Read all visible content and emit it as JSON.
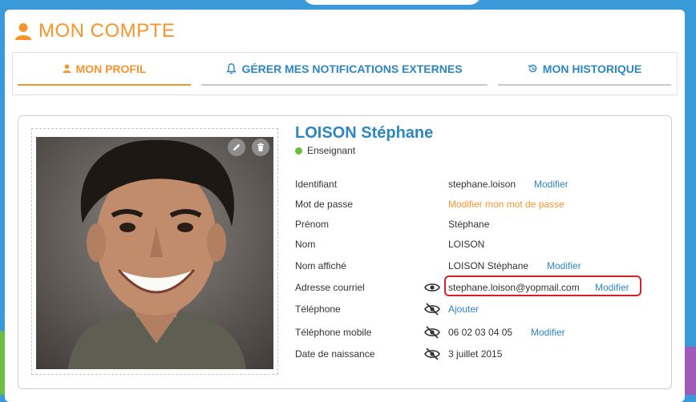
{
  "header": {
    "title": "MON COMPTE"
  },
  "tabs": [
    {
      "label": "MON PROFIL",
      "icon": "user-icon",
      "active": true
    },
    {
      "label": "GÉRER MES NOTIFICATIONS EXTERNES",
      "icon": "bell-icon",
      "active": false
    },
    {
      "label": "MON HISTORIQUE",
      "icon": "history-icon",
      "active": false
    }
  ],
  "profile": {
    "name": "LOISON Stéphane",
    "role": "Enseignant",
    "photo_actions": {
      "edit_icon": "pencil-icon",
      "delete_icon": "trash-icon"
    },
    "fields": {
      "identifiant": {
        "label": "Identifiant",
        "value": "stephane.loison",
        "action": "Modifier"
      },
      "password": {
        "label": "Mot de passe",
        "action": "Modifier mon mot de passe"
      },
      "prenom": {
        "label": "Prénom",
        "value": "Stéphane"
      },
      "nom": {
        "label": "Nom",
        "value": "LOISON"
      },
      "nom_affiche": {
        "label": "Nom affiché",
        "value": "LOISON Stéphane",
        "action": "Modifier"
      },
      "email": {
        "label": "Adresse courriel",
        "value": "stephane.loison@yopmail.com",
        "action": "Modifier",
        "visibility_icon": "eye-icon"
      },
      "telephone": {
        "label": "Téléphone",
        "action": "Ajouter",
        "visibility_icon": "eye-off-icon"
      },
      "mobile": {
        "label": "Téléphone mobile",
        "value": "06 02 03 04 05",
        "action": "Modifier",
        "visibility_icon": "eye-off-icon"
      },
      "naissance": {
        "label": "Date de naissance",
        "value": "3 juillet 2015",
        "visibility_icon": "eye-off-icon"
      }
    }
  },
  "colors": {
    "accent_orange": "#f7942c",
    "link_blue": "#2d86c4",
    "status_green": "#6bbd3f",
    "highlight_red": "#d6202a"
  }
}
